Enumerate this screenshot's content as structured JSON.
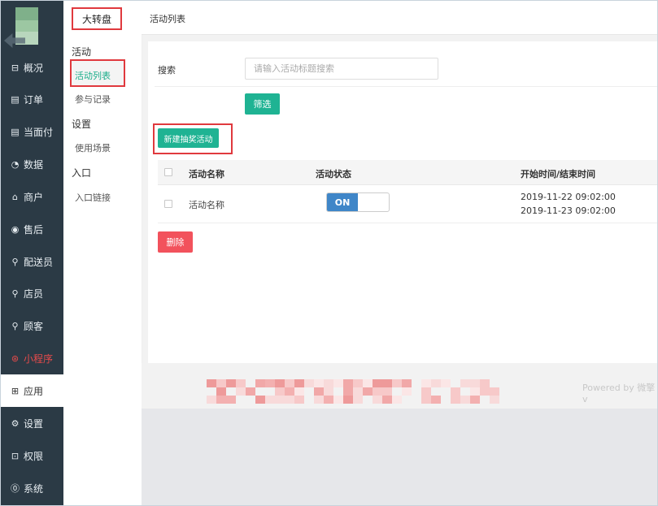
{
  "sidebar": {
    "items": [
      {
        "label": "概况",
        "icon": "overview-icon",
        "glyph": "⊟"
      },
      {
        "label": "订单",
        "icon": "order-icon",
        "glyph": "▤"
      },
      {
        "label": "当面付",
        "icon": "face-pay-icon",
        "glyph": "▤"
      },
      {
        "label": "数据",
        "icon": "data-icon",
        "glyph": "◔"
      },
      {
        "label": "商户",
        "icon": "merchant-icon",
        "glyph": "⌂"
      },
      {
        "label": "售后",
        "icon": "after-sales-icon",
        "glyph": "◉"
      },
      {
        "label": "配送员",
        "icon": "courier-icon",
        "glyph": "⚲"
      },
      {
        "label": "店员",
        "icon": "clerk-icon",
        "glyph": "⚲"
      },
      {
        "label": "顾客",
        "icon": "customer-icon",
        "glyph": "⚲"
      },
      {
        "label": "小程序",
        "icon": "mini-program-icon",
        "glyph": "⊛"
      },
      {
        "label": "应用",
        "icon": "apps-icon",
        "glyph": "⊞"
      },
      {
        "label": "设置",
        "icon": "settings-icon",
        "glyph": "⚙"
      },
      {
        "label": "权限",
        "icon": "lock-icon",
        "glyph": "⊡"
      },
      {
        "label": "系统",
        "icon": "system-icon",
        "glyph": "⓪"
      }
    ]
  },
  "submenu": {
    "title": "大转盘",
    "group_activity": "活动",
    "link_activity_list": "活动列表",
    "link_records": "参与记录",
    "group_settings": "设置",
    "link_scenes": "使用场景",
    "group_entry": "入口",
    "link_entry": "入口链接"
  },
  "header": {
    "title": "活动列表"
  },
  "search": {
    "label": "搜索",
    "placeholder": "请输入活动标题搜索",
    "filter_label": "筛选"
  },
  "actions": {
    "create_label": "新建抽奖活动",
    "delete_label": "删除"
  },
  "table": {
    "columns": [
      "活动名称",
      "活动状态",
      "开始时间/结束时间"
    ],
    "rows": [
      {
        "name": "活动名称",
        "status": "ON",
        "start": "2019-11-22 09:02:00",
        "end": "2019-11-23 09:02:00"
      }
    ]
  },
  "footer": {
    "powered": "Powered by 微擎 v"
  },
  "colors": {
    "sidebar_bg": "#2b3a45",
    "accent_green": "#1fb393",
    "toggle_blue": "#3f86c8",
    "delete_red": "#f2525c",
    "highlight_red": "#e0393e"
  }
}
